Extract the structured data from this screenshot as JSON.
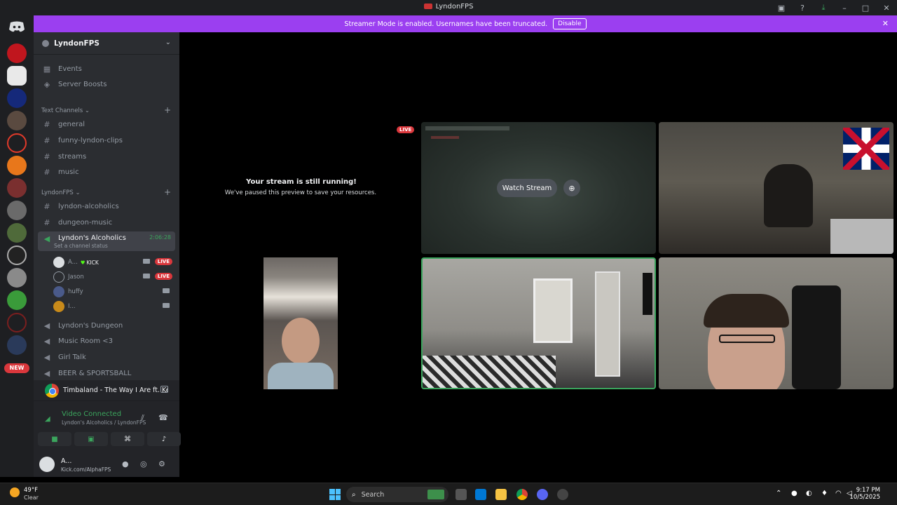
{
  "window": {
    "title": "LyndonFPS"
  },
  "banner": {
    "text": "Streamer Mode is enabled. Usernames have been truncated.",
    "disable_label": "Disable"
  },
  "guild_badge": "NEW",
  "server": {
    "name": "LyndonFPS"
  },
  "sidebar": {
    "top_items": [
      {
        "label": "Events"
      },
      {
        "label": "Server Boosts"
      }
    ],
    "text_category": "Text Channels",
    "text_channels": [
      "general",
      "funny-lyndon-clips",
      "streams",
      "music"
    ],
    "second_category": "LyndonFPS",
    "second_channels": [
      "lyndon-alcoholics",
      "dungeon-music"
    ],
    "active_voice": {
      "name": "Lyndon's Alcoholics",
      "time": "2:06:28",
      "status": "Set a channel status"
    },
    "voice_users": [
      {
        "name": "A...",
        "kick": "KICK",
        "live": "LIVE"
      },
      {
        "name": "Jason",
        "live": "LIVE"
      },
      {
        "name": "huffy"
      },
      {
        "name": "I..."
      }
    ],
    "other_voice": [
      "Lyndon's Dungeon",
      "Music Room <3",
      "Girl Talk",
      "BEER & SPORTSBALL"
    ]
  },
  "now_playing": {
    "text": "Timbaland - The Way I Are ft. Keri Hil..."
  },
  "voice_panel": {
    "status": "Video Connected",
    "location": "Lyndon's Alcoholics / LyndonFPS"
  },
  "user": {
    "name": "A...",
    "status": "Kick.com/AlphaFPS"
  },
  "stage": {
    "paused_title": "Your stream is still running!",
    "paused_sub": "We've paused this preview to save your resources.",
    "live_tag": "LIVE",
    "watch_label": "Watch Stream"
  },
  "taskbar": {
    "temp": "49°F",
    "condition": "Clear",
    "search": "Search",
    "time": "9:17 PM",
    "date": "10/5/2025"
  },
  "colors": {
    "accent": "#9b3ff0",
    "live": "#da373c",
    "voice": "#3ba55d"
  }
}
